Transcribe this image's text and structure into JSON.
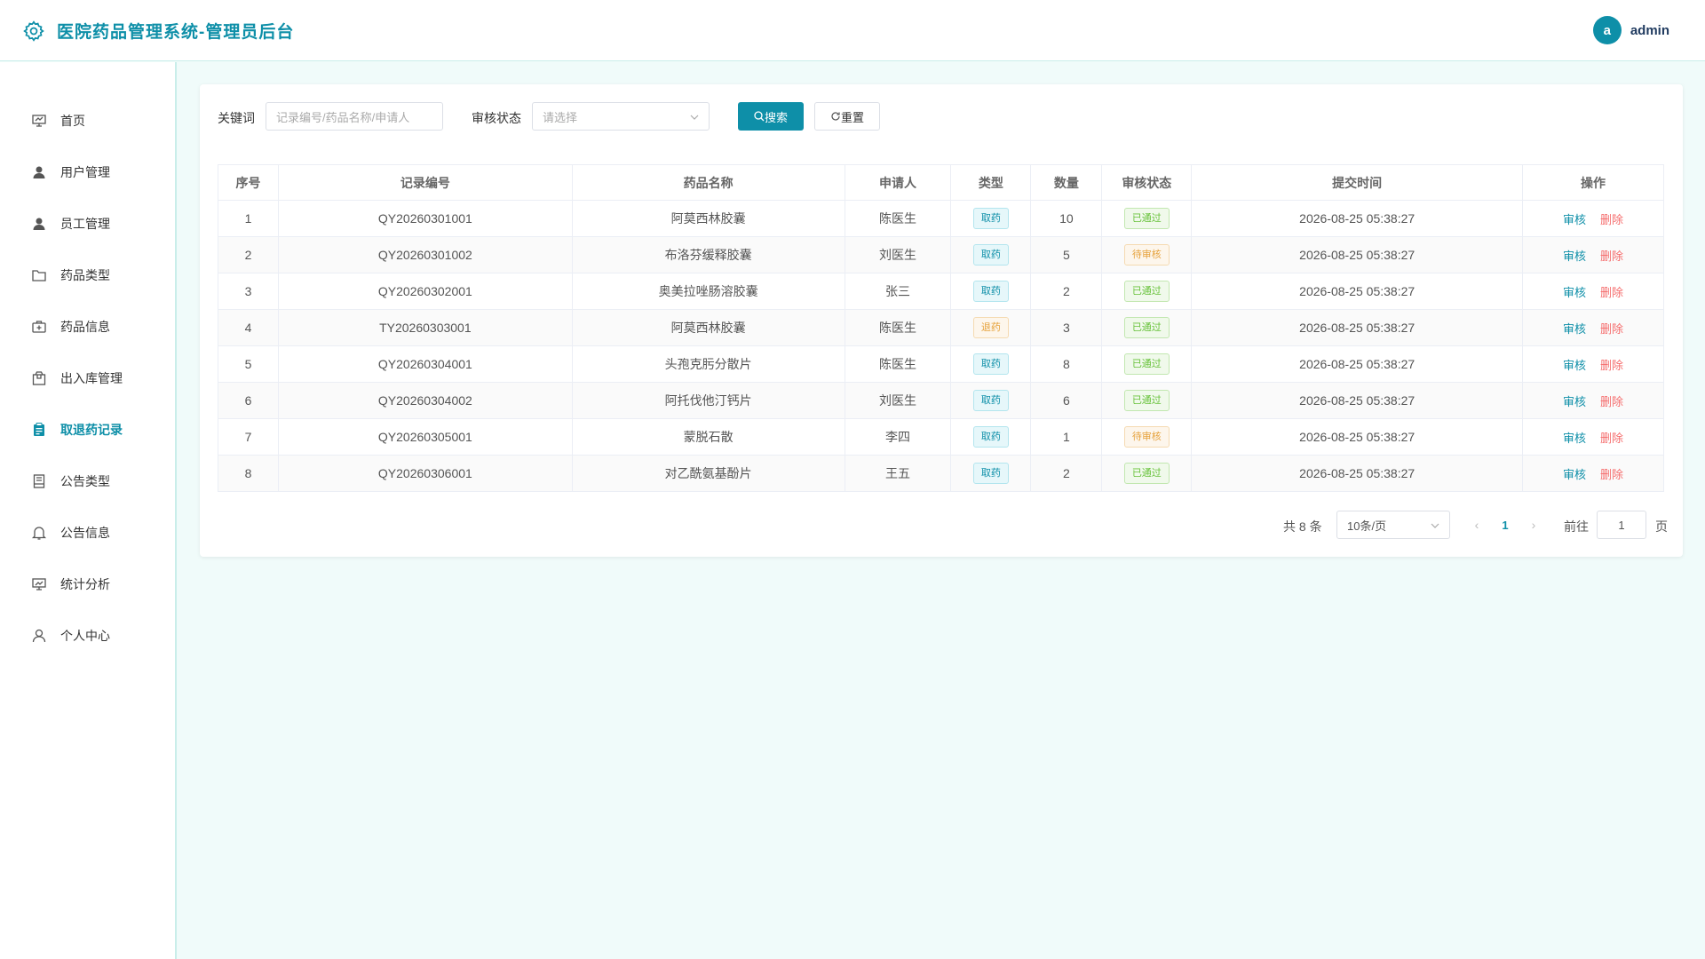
{
  "header": {
    "title": "医院药品管理系统-管理员后台",
    "avatar_letter": "a",
    "username": "admin"
  },
  "sidebar": {
    "items": [
      {
        "label": "首页",
        "icon": "monitor-icon"
      },
      {
        "label": "用户管理",
        "icon": "user-filled-icon"
      },
      {
        "label": "员工管理",
        "icon": "user-filled-icon"
      },
      {
        "label": "药品类型",
        "icon": "folder-icon"
      },
      {
        "label": "药品信息",
        "icon": "first-aid-kit-icon"
      },
      {
        "label": "出入库管理",
        "icon": "box-icon"
      },
      {
        "label": "取退药记录",
        "icon": "clipboard-icon",
        "active": true
      },
      {
        "label": "公告类型",
        "icon": "notebook-icon"
      },
      {
        "label": "公告信息",
        "icon": "bell-icon"
      },
      {
        "label": "统计分析",
        "icon": "chart-board-icon"
      },
      {
        "label": "个人中心",
        "icon": "user-icon"
      }
    ]
  },
  "filters": {
    "keyword_label": "关键词",
    "keyword_placeholder": "记录编号/药品名称/申请人",
    "status_label": "审核状态",
    "status_placeholder": "请选择",
    "search_label": "搜索",
    "reset_label": "重置"
  },
  "table": {
    "columns": [
      "序号",
      "记录编号",
      "药品名称",
      "申请人",
      "类型",
      "数量",
      "审核状态",
      "提交时间",
      "操作"
    ],
    "rows": [
      {
        "no": "1",
        "code": "QY20260301001",
        "drug": "阿莫西林胶囊",
        "applicant": "陈医生",
        "type": "取药",
        "qty": "10",
        "status": "已通过",
        "time": "2026-08-25 05:38:27"
      },
      {
        "no": "2",
        "code": "QY20260301002",
        "drug": "布洛芬缓释胶囊",
        "applicant": "刘医生",
        "type": "取药",
        "qty": "5",
        "status": "待审核",
        "time": "2026-08-25 05:38:27"
      },
      {
        "no": "3",
        "code": "QY20260302001",
        "drug": "奥美拉唑肠溶胶囊",
        "applicant": "张三",
        "type": "取药",
        "qty": "2",
        "status": "已通过",
        "time": "2026-08-25 05:38:27"
      },
      {
        "no": "4",
        "code": "TY20260303001",
        "drug": "阿莫西林胶囊",
        "applicant": "陈医生",
        "type": "退药",
        "qty": "3",
        "status": "已通过",
        "time": "2026-08-25 05:38:27"
      },
      {
        "no": "5",
        "code": "QY20260304001",
        "drug": "头孢克肟分散片",
        "applicant": "陈医生",
        "type": "取药",
        "qty": "8",
        "status": "已通过",
        "time": "2026-08-25 05:38:27"
      },
      {
        "no": "6",
        "code": "QY20260304002",
        "drug": "阿托伐他汀钙片",
        "applicant": "刘医生",
        "type": "取药",
        "qty": "6",
        "status": "已通过",
        "time": "2026-08-25 05:38:27"
      },
      {
        "no": "7",
        "code": "QY20260305001",
        "drug": "蒙脱石散",
        "applicant": "李四",
        "type": "取药",
        "qty": "1",
        "status": "待审核",
        "time": "2026-08-25 05:38:27"
      },
      {
        "no": "8",
        "code": "QY20260306001",
        "drug": "对乙酰氨基酚片",
        "applicant": "王五",
        "type": "取药",
        "qty": "2",
        "status": "已通过",
        "time": "2026-08-25 05:38:27"
      }
    ],
    "op_audit": "审核",
    "op_delete": "删除"
  },
  "pagination": {
    "total_text": "共 8 条",
    "page_size": "10条/页",
    "current_page": "1",
    "goto_label": "前往",
    "goto_value": "1",
    "page_suffix": "页"
  },
  "colors": {
    "primary": "#0e8fa8",
    "danger": "#f56c6c",
    "success": "#67c23a",
    "warning": "#e6a23c"
  }
}
